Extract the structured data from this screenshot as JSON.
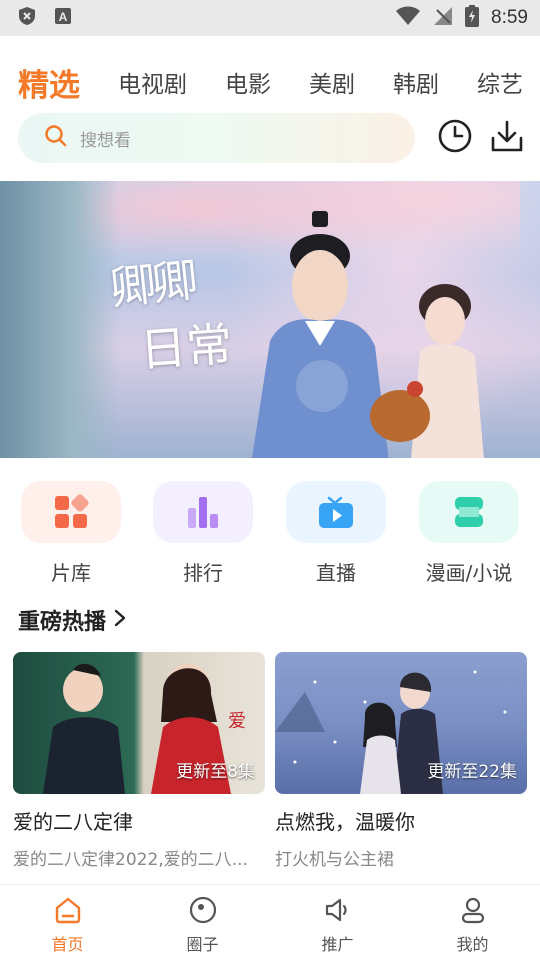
{
  "status": {
    "time": "8:59"
  },
  "tabs": [
    "精选",
    "电视剧",
    "电影",
    "美剧",
    "韩剧",
    "综艺"
  ],
  "search": {
    "placeholder": "搜想看"
  },
  "banner": {
    "title_line1": "卿卿",
    "title_line2": "日常"
  },
  "quick": [
    {
      "label": "片库",
      "icon": "grid-icon",
      "bg": "#fff0ec",
      "color": "#f46a48"
    },
    {
      "label": "排行",
      "icon": "bar-chart-icon",
      "bg": "#f4efff",
      "color": "#a36ff0"
    },
    {
      "label": "直播",
      "icon": "tv-icon",
      "bg": "#eaf5ff",
      "color": "#38a4f5"
    },
    {
      "label": "漫画/小说",
      "icon": "book-icon",
      "bg": "#e6fbf6",
      "color": "#2fcfac"
    }
  ],
  "section": {
    "title": "重磅热播"
  },
  "cards": [
    {
      "name": "爱的二八定律",
      "desc": "爱的二八定律2022,爱的二八...",
      "badge": "更新至8集"
    },
    {
      "name": "点燃我，温暖你",
      "desc": "打火机与公主裙",
      "badge": "更新至22集"
    }
  ],
  "nav": [
    {
      "label": "首页",
      "icon": "home-icon"
    },
    {
      "label": "圈子",
      "icon": "circle-icon"
    },
    {
      "label": "推广",
      "icon": "speaker-icon"
    },
    {
      "label": "我的",
      "icon": "user-icon"
    }
  ],
  "colors": {
    "accent": "#f47a2a"
  }
}
